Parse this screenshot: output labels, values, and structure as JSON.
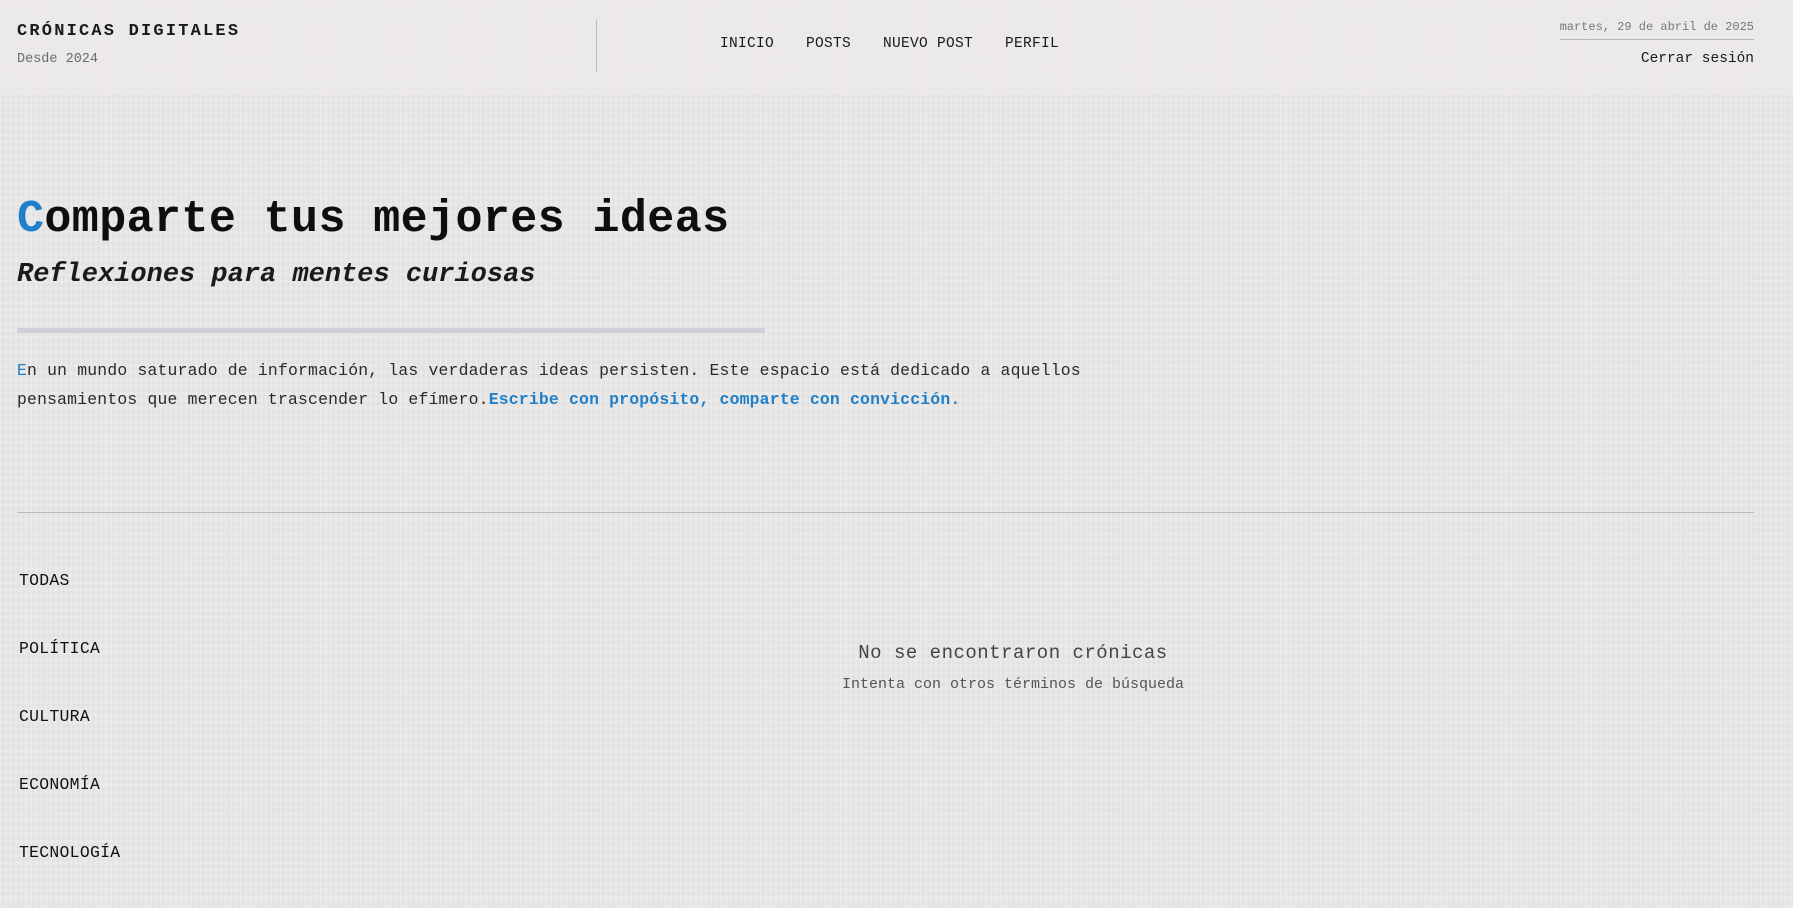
{
  "brand": {
    "title": "CRÓNICAS DIGITALES",
    "since": "Desde 2024"
  },
  "nav": {
    "items": [
      {
        "label": "INICIO"
      },
      {
        "label": "POSTS"
      },
      {
        "label": "NUEVO POST"
      },
      {
        "label": "PERFIL"
      }
    ]
  },
  "header": {
    "date": "martes, 29 de abril de 2025",
    "logout_label": "Cerrar sesión"
  },
  "hero": {
    "title_initial": "C",
    "title_rest": "omparte tus mejores ideas",
    "subtitle": "Reflexiones para mentes curiosas",
    "intro_initial": "E",
    "intro_text": "n un mundo saturado de información, las verdaderas ideas persisten. Este espacio está dedicado a aquellos pensamientos que merecen trascender lo efímero.",
    "intro_highlight": "Escribe con propósito, comparte con convicción."
  },
  "categories": {
    "items": [
      {
        "label": "TODAS"
      },
      {
        "label": "POLÍTICA"
      },
      {
        "label": "CULTURA"
      },
      {
        "label": "ECONOMÍA"
      },
      {
        "label": "TECNOLOGÍA"
      }
    ]
  },
  "empty_state": {
    "title": "No se encontraron crónicas",
    "subtitle": "Intenta con otros términos de búsqueda"
  },
  "colors": {
    "accent": "#1f7fc8",
    "background": "#ebe9e8",
    "text": "#111111"
  }
}
